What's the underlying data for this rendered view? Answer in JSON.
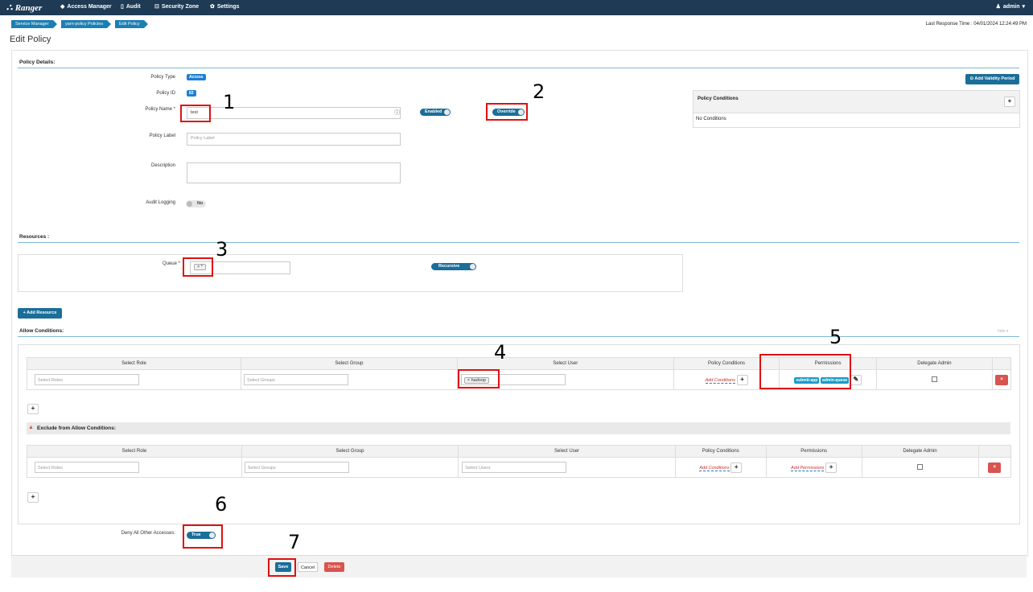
{
  "nav": {
    "brand": "Ranger",
    "access_manager": "Access Manager",
    "audit": "Audit",
    "security_zone": "Security Zone",
    "settings": "Settings",
    "user": "admin"
  },
  "breadcrumb": [
    "Service Manager",
    "yarn-policy Policies",
    "Edit Policy"
  ],
  "last_response": "Last Response Time : 04/01/2024 12:24:49 PM",
  "page_title": "Edit Policy",
  "policy_details": {
    "heading": "Policy Details:",
    "policy_type_label": "Policy Type",
    "policy_type_value": "Access",
    "policy_id_label": "Policy ID",
    "policy_id_value": "83",
    "policy_name_label": "Policy Name *",
    "policy_name_value": "test",
    "enabled_toggle": "Enabled",
    "override_toggle": "Override",
    "policy_label_label": "Policy Label",
    "policy_label_placeholder": "Policy Label",
    "description_label": "Description",
    "audit_logging_label": "Audit Logging",
    "audit_logging_value": "No",
    "add_validity_period": "Add Validity Period",
    "policy_conditions_header": "Policy Conditions",
    "no_conditions": "No Conditions"
  },
  "resources": {
    "heading": "Resources :",
    "queue_label": "Queue *",
    "queue_value": "*",
    "recursive_toggle": "Recursive",
    "add_resource": "Add Resource"
  },
  "allow": {
    "heading": "Allow Conditions:",
    "hide_label": "hide",
    "columns": [
      "Select Role",
      "Select Group",
      "Select User",
      "Policy Conditions",
      "Permissions",
      "Delegate Admin"
    ],
    "roles_placeholder": "Select Roles",
    "groups_placeholder": "Select Groups",
    "user_value": "hadoop",
    "add_conditions": "Add Conditions",
    "permissions": [
      "submit-app",
      "admin-queue"
    ]
  },
  "exclude": {
    "heading": "Exclude from Allow Conditions:",
    "columns": [
      "Select Role",
      "Select Group",
      "Select User",
      "Policy Conditions",
      "Permissions",
      "Delegate Admin"
    ],
    "roles_placeholder": "Select Roles",
    "groups_placeholder": "Select Groups",
    "users_placeholder": "Select Users",
    "add_conditions": "Add Conditions",
    "add_permissions": "Add Permissions"
  },
  "deny_all": {
    "label": "Deny All Other Accesses:",
    "value": "True"
  },
  "footer": {
    "save": "Save",
    "cancel": "Cancel",
    "delete": "Delete"
  },
  "annotations": [
    "1",
    "2",
    "3",
    "4",
    "5",
    "6",
    "7"
  ]
}
